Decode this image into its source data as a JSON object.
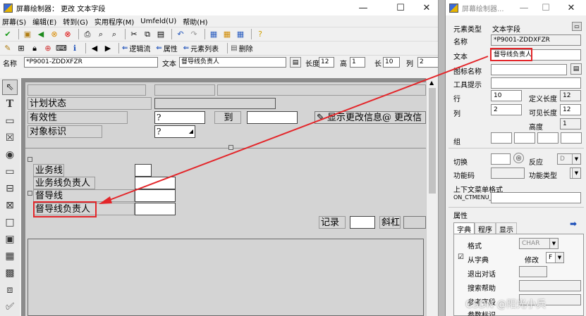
{
  "main_window": {
    "title": "屏幕绘制器： 更改 文本字段",
    "controls": {
      "minimize": "—",
      "maximize": "☐",
      "close": "✕"
    },
    "menu": [
      "屏幕(S)",
      "编辑(E)",
      "转到(G)",
      "实用程序(M)",
      "Umfeld(U)",
      "帮助(H)"
    ],
    "toolbar2": {
      "btn_logicflow": "逻辑流",
      "btn_attributes": "属性",
      "btn_elementlist": "元素列表",
      "btn_delete": "删除"
    },
    "namebar": {
      "name_label": "名称",
      "name_value": "*P9001-ZDDXFZR",
      "text_label": "文本",
      "text_value": "督导线负责人",
      "deflen_label": "长度",
      "deflen_value": "12",
      "height_label": "高",
      "height_value": "1",
      "len_label": "长",
      "len_value": "10",
      "col_label": "列",
      "col_value": "2"
    }
  },
  "screen": {
    "row1": {
      "plan_status": "计划状态"
    },
    "row2": {
      "validity": "有效性",
      "validity_value": "?",
      "to": "到"
    },
    "row3": {
      "object_id": "对象标识",
      "object_value": "?"
    },
    "change_info": "显示更改信息@ 更改信",
    "group2": [
      "业务线",
      "业务线负责人",
      "督导线",
      "督导线负责人"
    ],
    "record_label": "记录",
    "italic_label": "斜杠"
  },
  "property_window": {
    "title": "屏幕绘制器...",
    "element_type_label": "元素类型",
    "element_type_value": "文本字段",
    "name_label": "名称",
    "name_value": "*P9001-ZDDXFZR",
    "text_label": "文本",
    "text_value": "督导线负责人",
    "icon_name_label": "图标名称",
    "tooltip_label": "工具提示",
    "row_label": "行",
    "row_value": "10",
    "def_len_label": "定义长度",
    "def_len_value": "12",
    "col_label": "列",
    "col_value": "2",
    "vis_len_label": "可见长度",
    "vis_len_value": "12",
    "height_label": "高度",
    "height_value": "1",
    "group_label": "组",
    "switch_label": "切换",
    "response_label": "反应",
    "response_value": "D",
    "fcode_label": "功能码",
    "ftype_label": "功能类型",
    "ctx_menu_label": "上下文菜单格式",
    "ctx_menu_prefix": "ON_CTMENU_",
    "attributes_label": "属性",
    "tabs": [
      "字典",
      "程序",
      "显示"
    ],
    "format_label": "格式",
    "format_value": "CHAR",
    "from_dict_label": "从字典",
    "modify_label": "修改",
    "modify_value": "F",
    "exit_dialog_label": "退出对话",
    "search_help_label": "搜索帮助",
    "ref_field_label": "参考字段",
    "param_id_label": "参数标识"
  },
  "watermark": "CSDN @阳光小兵",
  "colors": {
    "highlight": "#e3262a",
    "arrow": "#e3262a",
    "canvas": "#8c8c8c",
    "screen": "#d4d4d4"
  }
}
